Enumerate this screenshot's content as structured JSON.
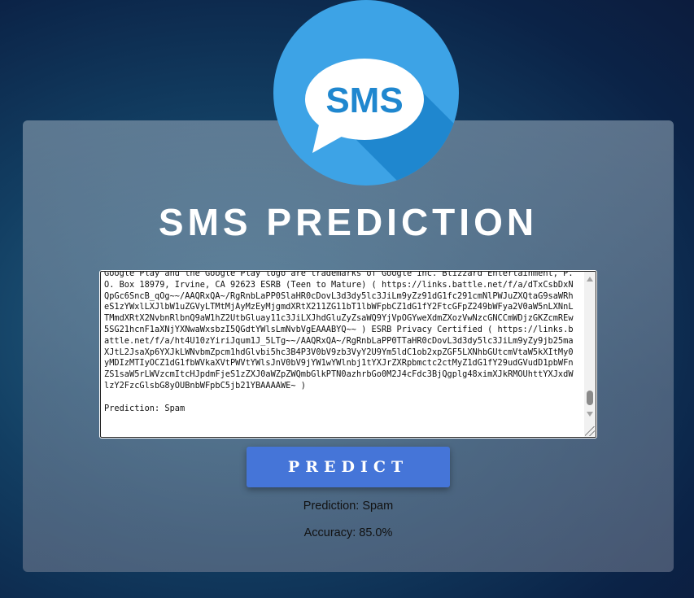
{
  "app": {
    "title": "SMS PREDICTION",
    "logo_text": "SMS"
  },
  "input": {
    "message": "Google Play and the Google Play logo are trademarks of Google Inc. Blizzard Entertainment, P.O. Box 18979, Irvine, CA 92623 ESRB (Teen to Mature) ( https://links.battle.net/f/a/dTxCsbDxNQpGc6SncB_qOg~~/AAQRxQA~/RgRnbLaPP0SlaHR0cDovL3d3dy5lc3JiLm9yZz91dG1fc291cmNlPWJuZXQtaG9saWRheS1zYWxlLXJlbW1uZGVyLTMtMjAyMzEyMjgmdXRtX211ZG11bT1lbWFpbCZ1dG1fY2FtcGFpZ249bWFya2V0aW5nLXNnLTMmdXRtX2NvbnRlbnQ9aW1hZ2UtbGluay11c3JiLXJhdGluZyZsaWQ9YjVpOGYweXdmZXozVwNzcGNCCmWDjzGKZcmREw5SG21hcnF1aXNjYXNwaWxsbzI5QGdtYWlsLmNvbVgEAAABYQ~~ ) ESRB Privacy Certified ( https://links.battle.net/f/a/ht4U10zYiriJqum1J_5LTg~~/AAQRxQA~/RgRnbLaPP0TTaHR0cDovL3d3dy5lc3JiLm9yZy9jb25maXJtL2JsaXp6YXJkLWNvbmZpcm1hdGlvbi5hc3B4P3V0bV9zb3VyY2U9Ym5ldC1ob2xpZGF5LXNhbGUtcmVtaW5kXItMy0yMDIzMTIyOCZ1dG1fbWVkaXVtPWVtYWlsJnV0bV9jYW1wYWlnbj1tYXJrZXRpbmctc2ctMyZ1dG1fY29udGVudD1pbWFnZS1saW5rLWVzcmItcHJpdmFjeS1zZXJ0aWZpZWQmbGlkPTN0azhrbGo0M2J4cFdc3BjQgplg48ximXJkRMOUhttYXJxdWlzY2FzcGlsbG8yOUBnbWFpbC5jb21YBAAAAWE~ )\n\nPrediction: Spam"
  },
  "actions": {
    "predict_label": "PREDICT"
  },
  "result": {
    "prediction": "Prediction: Spam",
    "accuracy": "Accuracy: 85.0%"
  },
  "colors": {
    "logo_blue": "#3da3e6",
    "logo_dark": "#1f87cf",
    "button": "#4575d8",
    "sms_text": "#1f87cf"
  }
}
